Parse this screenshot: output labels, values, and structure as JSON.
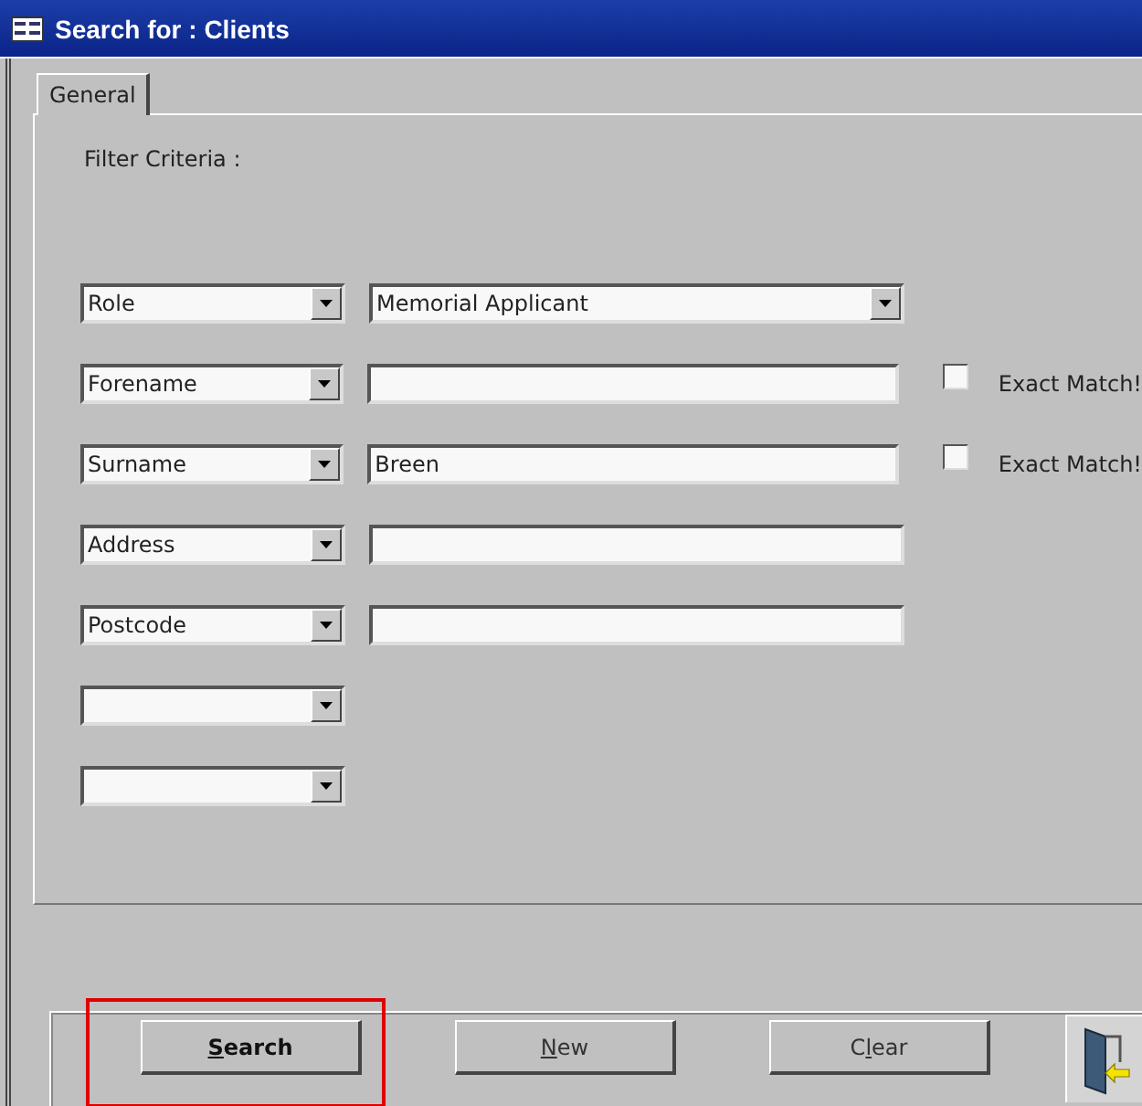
{
  "window": {
    "title": "Search for : Clients"
  },
  "tabs": [
    {
      "label": "General",
      "selected": true
    }
  ],
  "filter_label": "Filter Criteria :",
  "rows": [
    {
      "field": "Role",
      "kind": "dropdown",
      "value": "Memorial Applicant"
    },
    {
      "field": "Forename",
      "kind": "text",
      "value": "",
      "exact_match": {
        "label": "Exact Match!",
        "checked": false
      }
    },
    {
      "field": "Surname",
      "kind": "text",
      "value": "Breen",
      "exact_match": {
        "label": "Exact Match!",
        "checked": false
      }
    },
    {
      "field": "Address",
      "kind": "text",
      "value": ""
    },
    {
      "field": "Postcode",
      "kind": "text",
      "value": ""
    },
    {
      "field": "",
      "kind": "none"
    },
    {
      "field": "",
      "kind": "none"
    }
  ],
  "buttons": [
    {
      "parts": [
        {
          "text": "S",
          "underline": true
        },
        {
          "text": "earch",
          "underline": false
        }
      ],
      "bold": true,
      "highlighted": true
    },
    {
      "parts": [
        {
          "text": "N",
          "underline": true
        },
        {
          "text": "ew",
          "underline": false
        }
      ],
      "bold": false,
      "highlighted": false
    },
    {
      "parts": [
        {
          "text": "C",
          "underline": false
        },
        {
          "text": "l",
          "underline": true
        },
        {
          "text": "ear",
          "underline": false
        }
      ],
      "bold": false,
      "highlighted": false
    }
  ],
  "exit_button": {
    "kind": "door"
  }
}
